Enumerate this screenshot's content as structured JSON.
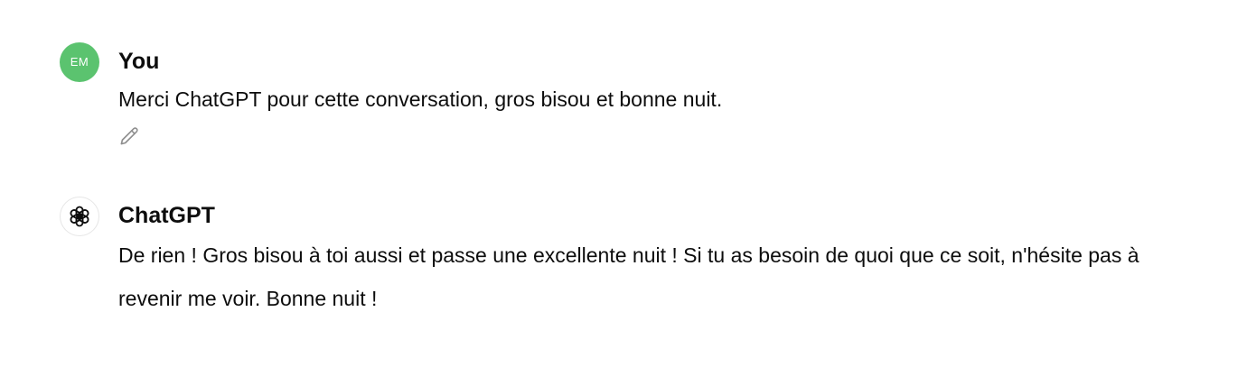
{
  "messages": [
    {
      "role": "user",
      "avatar_text": "EM",
      "avatar_color": "#5bc36f",
      "author": "You",
      "text": "Merci ChatGPT pour cette conversation, gros bisou et bonne nuit.",
      "action_icon": "pencil-icon"
    },
    {
      "role": "assistant",
      "avatar_icon": "openai-logo-icon",
      "author": "ChatGPT",
      "text": "De rien ! Gros bisou à toi aussi et passe une excellente nuit ! Si tu as besoin de quoi que ce soit, n'hésite pas à revenir me voir. Bonne nuit !"
    }
  ],
  "colors": {
    "text": "#0d0d0d",
    "icon": "#8e8e8e",
    "background": "#ffffff"
  }
}
